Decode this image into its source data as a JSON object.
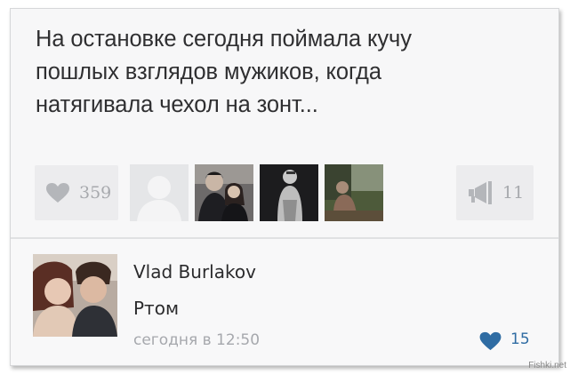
{
  "post": {
    "lines": [
      "На остановке сегодня поймала кучу",
      "пошлых взглядов мужиков, когда",
      "натягивала чехол на зонт..."
    ]
  },
  "actions": {
    "likes_count": "359",
    "shares_count": "11",
    "like_icon": "heart-icon",
    "share_icon": "megaphone-icon",
    "liker_thumbnails": [
      "placeholder-avatar",
      "couple-photo",
      "person-photo",
      "outdoor-photo"
    ]
  },
  "comment": {
    "author": "Vlad Burlakov",
    "text": "Ртом",
    "timestamp": "сегодня в 12:50",
    "likes_count": "15"
  },
  "watermark": "Fishki.net",
  "colors": {
    "background": "#f7f7f8",
    "button_bg": "#ececee",
    "muted_icon": "#b4b6ba",
    "liked_heart": "#2f6ca3",
    "text": "#2f2f31"
  }
}
